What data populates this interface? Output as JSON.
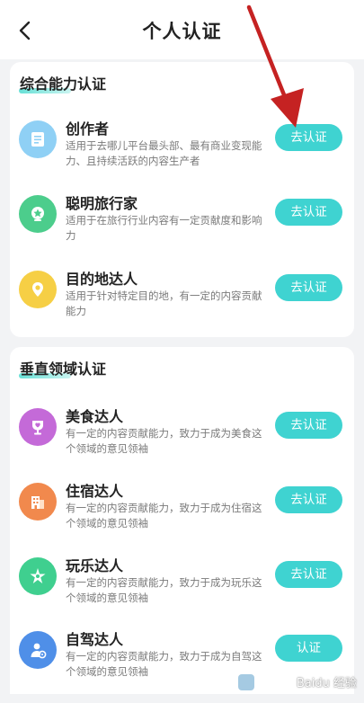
{
  "header": {
    "title": "个人认证"
  },
  "sections": [
    {
      "title": "综合能力认证",
      "items": [
        {
          "title": "创作者",
          "desc": "适用于去哪儿平台最头部、最有商业变现能力、且持续活跃的内容生产者",
          "button": "去认证",
          "icon": "document-icon",
          "color": "#7fc6f2"
        },
        {
          "title": "聪明旅行家",
          "desc": "适用于在旅行行业内容有一定贡献度和影响力",
          "button": "去认证",
          "icon": "medal-icon",
          "color": "#4ccd8c"
        },
        {
          "title": "目的地达人",
          "desc": "适用于针对特定目的地，有一定的内容贡献能力",
          "button": "去认证",
          "icon": "location-pin-icon",
          "color": "#f6cf45"
        }
      ]
    },
    {
      "title": "垂直领域认证",
      "items": [
        {
          "title": "美食达人",
          "desc": "有一定的内容贡献能力，致力于成为美食这个领域的意见领袖",
          "button": "去认证",
          "icon": "food-trophy-icon",
          "color": "#c46ad8"
        },
        {
          "title": "住宿达人",
          "desc": "有一定的内容贡献能力，致力于成为住宿这个领域的意见领袖",
          "button": "去认证",
          "icon": "building-icon",
          "color": "#f1894d"
        },
        {
          "title": "玩乐达人",
          "desc": "有一定的内容贡献能力，致力于成为玩乐这个领域的意见领袖",
          "button": "去认证",
          "icon": "sparkle-icon",
          "color": "#3fcf8f"
        },
        {
          "title": "自驾达人",
          "desc": "有一定的内容贡献能力，致力于成为自驾这个领域的意见领袖",
          "button": "认证",
          "icon": "driver-icon",
          "color": "#4f8fe8"
        }
      ]
    }
  ],
  "colors": {
    "accent": "#3fd3d1",
    "annotation": "#c52222"
  },
  "watermark": {
    "text": "Baidu 经验"
  }
}
